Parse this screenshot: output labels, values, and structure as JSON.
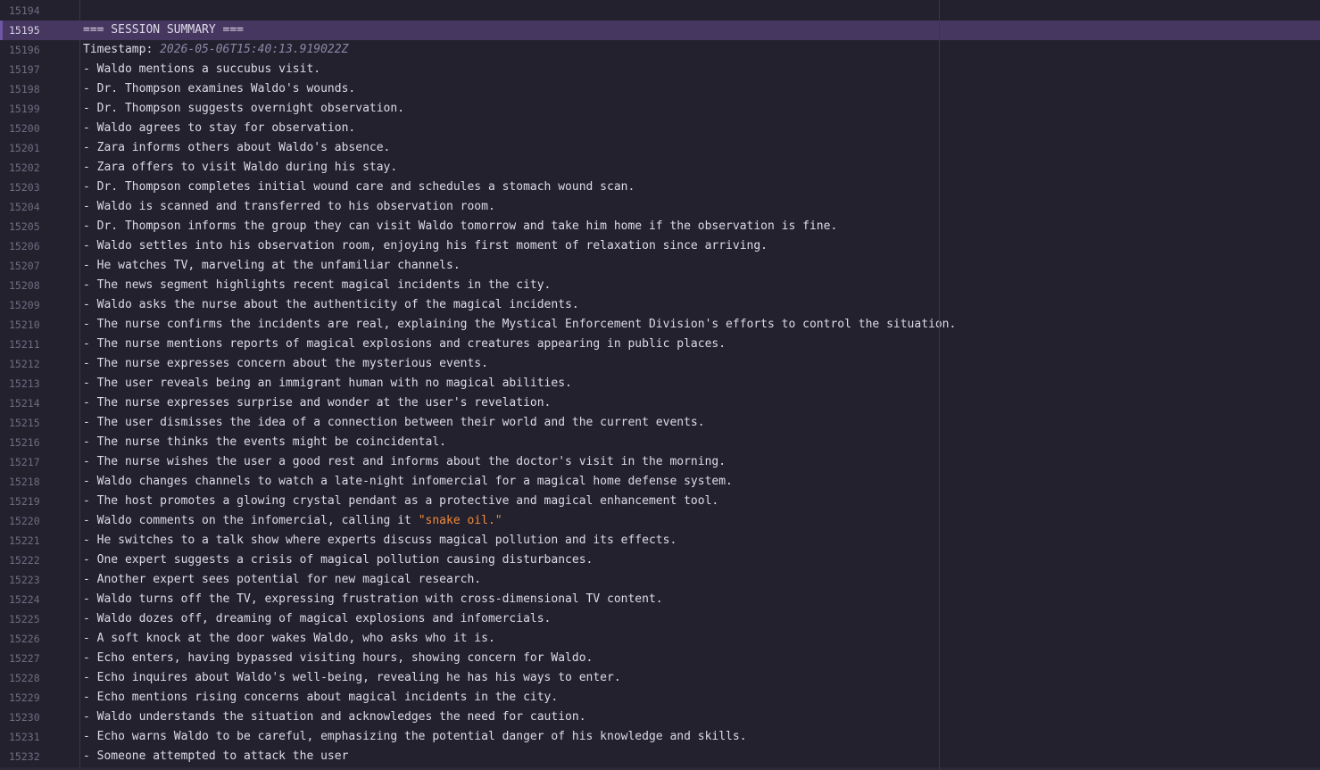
{
  "editor": {
    "active_line": "15195",
    "lines": [
      {
        "n": "15194",
        "t": ""
      },
      {
        "n": "15195",
        "t": "=== SESSION SUMMARY ==="
      },
      {
        "n": "15196",
        "label": "Timestamp: ",
        "ts": "2026-05-06T15:40:13.919022Z"
      },
      {
        "n": "15197",
        "t": "- Waldo mentions a succubus visit."
      },
      {
        "n": "15198",
        "t": "- Dr. Thompson examines Waldo's wounds."
      },
      {
        "n": "15199",
        "t": "- Dr. Thompson suggests overnight observation."
      },
      {
        "n": "15200",
        "t": "- Waldo agrees to stay for observation."
      },
      {
        "n": "15201",
        "t": "- Zara informs others about Waldo's absence."
      },
      {
        "n": "15202",
        "t": "- Zara offers to visit Waldo during his stay."
      },
      {
        "n": "15203",
        "t": "- Dr. Thompson completes initial wound care and schedules a stomach wound scan."
      },
      {
        "n": "15204",
        "t": "- Waldo is scanned and transferred to his observation room."
      },
      {
        "n": "15205",
        "t": "- Dr. Thompson informs the group they can visit Waldo tomorrow and take him home if the observation is fine."
      },
      {
        "n": "15206",
        "t": "- Waldo settles into his observation room, enjoying his first moment of relaxation since arriving."
      },
      {
        "n": "15207",
        "t": "- He watches TV, marveling at the unfamiliar channels."
      },
      {
        "n": "15208",
        "t": "- The news segment highlights recent magical incidents in the city."
      },
      {
        "n": "15209",
        "t": "- Waldo asks the nurse about the authenticity of the magical incidents."
      },
      {
        "n": "15210",
        "t": "- The nurse confirms the incidents are real, explaining the Mystical Enforcement Division's efforts to control the situation."
      },
      {
        "n": "15211",
        "t": "- The nurse mentions reports of magical explosions and creatures appearing in public places."
      },
      {
        "n": "15212",
        "t": "- The nurse expresses concern about the mysterious events."
      },
      {
        "n": "15213",
        "t": "- The user reveals being an immigrant human with no magical abilities."
      },
      {
        "n": "15214",
        "t": "- The nurse expresses surprise and wonder at the user's revelation."
      },
      {
        "n": "15215",
        "t": "- The user dismisses the idea of a connection between their world and the current events."
      },
      {
        "n": "15216",
        "t": "- The nurse thinks the events might be coincidental."
      },
      {
        "n": "15217",
        "t": "- The nurse wishes the user a good rest and informs about the doctor's visit in the morning."
      },
      {
        "n": "15218",
        "t": "- Waldo changes channels to watch a late-night infomercial for a magical home defense system."
      },
      {
        "n": "15219",
        "t": "- The host promotes a glowing crystal pendant as a protective and magical enhancement tool."
      },
      {
        "n": "15220",
        "t": "- Waldo comments on the infomercial, calling it ",
        "str": "\"snake oil.\""
      },
      {
        "n": "15221",
        "t": "- He switches to a talk show where experts discuss magical pollution and its effects."
      },
      {
        "n": "15222",
        "t": "- One expert suggests a crisis of magical pollution causing disturbances."
      },
      {
        "n": "15223",
        "t": "- Another expert sees potential for new magical research."
      },
      {
        "n": "15224",
        "t": "- Waldo turns off the TV, expressing frustration with cross-dimensional TV content."
      },
      {
        "n": "15225",
        "t": "- Waldo dozes off, dreaming of magical explosions and infomercials."
      },
      {
        "n": "15226",
        "t": "- A soft knock at the door wakes Waldo, who asks who it is."
      },
      {
        "n": "15227",
        "t": "- Echo enters, having bypassed visiting hours, showing concern for Waldo."
      },
      {
        "n": "15228",
        "t": "- Echo inquires about Waldo's well-being, revealing he has his ways to enter."
      },
      {
        "n": "15229",
        "t": "- Echo mentions rising concerns about magical incidents in the city."
      },
      {
        "n": "15230",
        "t": "- Waldo understands the situation and acknowledges the need for caution."
      },
      {
        "n": "15231",
        "t": "- Echo warns Waldo to be careful, emphasizing the potential danger of his knowledge and skills."
      },
      {
        "n": "15232",
        "t": "- Someone attempted to attack the user"
      }
    ]
  },
  "colors": {
    "background": "#23212e",
    "active_line": "#463760",
    "text": "#dedbe8",
    "line_number": "#6f6c80",
    "timestamp": "#8a87a6",
    "string": "#f08a3a"
  }
}
